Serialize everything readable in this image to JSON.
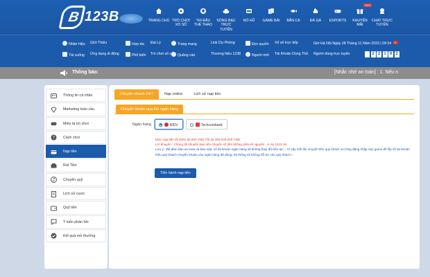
{
  "brand": {
    "name": "123B"
  },
  "menu": [
    {
      "label": "TRANG CHỦ",
      "icon": "home-icon"
    },
    {
      "label": "TRÒ CHƠI XỔ SỐ",
      "icon": "lottery-icon"
    },
    {
      "label": "THI ĐẤU THỂ THAO",
      "icon": "sports-icon"
    },
    {
      "label": "SÒNG BẠC TRỰC TUYẾN",
      "icon": "casino-icon"
    },
    {
      "label": "NỔ HŨ",
      "icon": "slot-icon"
    },
    {
      "label": "GAME BÀI",
      "icon": "cards-icon"
    },
    {
      "label": "BẮN CÁ",
      "icon": "fish-icon"
    },
    {
      "label": "ĐÁ GÀ",
      "icon": "rooster-icon"
    },
    {
      "label": "ESPORTS",
      "icon": "gamepad-icon"
    },
    {
      "label": "KHUYẾN MÃI",
      "icon": "gift-icon",
      "badge": "HOT"
    },
    {
      "label": "CHAT TRỰC TUYẾN",
      "icon": "chat-icon"
    }
  ],
  "subnav": {
    "row1": [
      "Nhận hiệu",
      "Giới Thiệu",
      "Hợp tác",
      "Đại Lý",
      "Trang mạng",
      "Link Dự Phòng",
      "Đọc quyền",
      "Xổ số trực tiếp"
    ],
    "row2": [
      "Tải xuống",
      "Ứng dụng di động",
      "Phổ biến",
      "Trò chơi số số",
      "Quảng cáo",
      "Thương hiệu 1238",
      "Người mới",
      "Tài Khoản Dùng Thử"
    ],
    "clock": "Giờ Hà Nội   Ngày 28 Tháng 11 Năm 2023 | 09:34",
    "online_label": "Người dùng trực tuyến",
    "online_digits": [
      "",
      "2",
      "2",
      "1",
      "9",
      "2"
    ]
  },
  "notice": {
    "label": "Thông báo:",
    "text": "[Nhắc nhở an toàn] :   1. Nếu n"
  },
  "sidebar": [
    {
      "label": "Thông tin cá nhân",
      "icon": "user-card-icon"
    },
    {
      "label": "Marketing toàn cầu",
      "icon": "diamond-icon"
    },
    {
      "label": "Miêu tả trò chơi",
      "icon": "gamepad-icon"
    },
    {
      "label": "Cách chơi",
      "icon": "help-icon"
    },
    {
      "label": "Nạp tiền",
      "icon": "deposit-icon",
      "active": true
    },
    {
      "label": "Rút Tiền",
      "icon": "withdraw-icon"
    },
    {
      "label": "Chuyển quỹ",
      "icon": "transfer-icon"
    },
    {
      "label": "Lịch sử cược",
      "icon": "history-icon"
    },
    {
      "label": "Quỹ tiền",
      "icon": "wallet-icon"
    },
    {
      "label": "Ý kiến phản hồi",
      "icon": "feedback-icon"
    },
    {
      "label": "Kết quả mở thưởng",
      "icon": "result-icon"
    }
  ],
  "tabs": [
    "Chuyển nhanh 24/7",
    "Nạp online",
    "Lịch sử nạp tiền"
  ],
  "subtab": "Chuyển khoản qua thẻ ngân hàng",
  "bank_label": "Ngân hàng",
  "banks": [
    {
      "name": "BIDV",
      "selected": true
    },
    {
      "name": "Techcombank",
      "selected": false
    }
  ],
  "info": {
    "line1": "Mức nạp tiền tối thiểu 50.000 VND Tối đa 300.000.000 VND",
    "line2": "Lời khuyên : Chúng tôi khuyến bạn nên chuyển số tiền không phải số nguyên , ví dụ 1023.19",
    "line3": "Lưu ý : Để đảm bảo an toàn và bảo mật, số tài khoản ngân hàng sẽ không thay đổi liên tục... Vì vậy mỗi lần chuyển tiền quý khách vui lòng đăng nhập vào game để lấy số tài khoản hiểu quý khách chuyển khoản vào ngân hàng đã đóng, hệ thống sẽ không hỗ trợ cho quý khách !"
  },
  "submit_label": "Tiến hành nạp tiền",
  "colors": {
    "primary": "#1c5aab",
    "accent": "#f5a623",
    "warning": "#e53935"
  }
}
